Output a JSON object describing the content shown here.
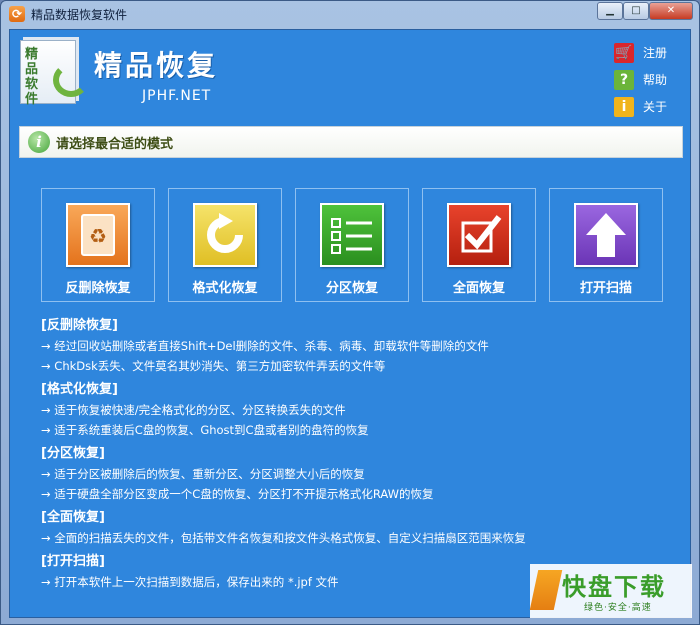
{
  "window": {
    "title": "精品数据恢复软件",
    "controls": {
      "minimize": "▁",
      "maximize": "□",
      "close": "✕"
    }
  },
  "brand": {
    "logo_text": "精品软件",
    "title": "精品恢复",
    "url": "JPHF.NET"
  },
  "toplinks": [
    {
      "label": "注册",
      "icon": "cart-icon",
      "color": "#d9262c"
    },
    {
      "label": "帮助",
      "icon": "help-icon",
      "color": "#6bb43a"
    },
    {
      "label": "关于",
      "icon": "info-icon",
      "color": "#f0b41c"
    }
  ],
  "notice": {
    "text": "请选择最合适的模式"
  },
  "modes": [
    {
      "label": "反删除恢复",
      "icon": "recycle-icon",
      "color": "#e98224"
    },
    {
      "label": "格式化恢复",
      "icon": "refresh-icon",
      "color": "#e7cc37"
    },
    {
      "label": "分区恢复",
      "icon": "checklist-icon",
      "color": "#35a928"
    },
    {
      "label": "全面恢复",
      "icon": "checkmark-icon",
      "color": "#d2321b"
    },
    {
      "label": "打开扫描",
      "icon": "arrow-up-icon",
      "color": "#7f4bcb"
    }
  ],
  "descriptions": [
    {
      "title": "[反删除恢复]",
      "lines": [
        "→ 经过回收站删除或者直接Shift+Del删除的文件、杀毒、病毒、卸载软件等删除的文件",
        "→ ChkDsk丢失、文件莫名其妙消失、第三方加密软件弄丢的文件等"
      ]
    },
    {
      "title": "[格式化恢复]",
      "lines": [
        "→ 适于恢复被快速/完全格式化的分区、分区转换丢失的文件",
        "→ 适于系统重装后C盘的恢复、Ghost到C盘或者别的盘符的恢复"
      ]
    },
    {
      "title": "[分区恢复]",
      "lines": [
        "→ 适于分区被删除后的恢复、重新分区、分区调整大小后的恢复",
        "→ 适于硬盘全部分区变成一个C盘的恢复、分区打不开提示格式化RAW的恢复"
      ]
    },
    {
      "title": "[全面恢复]",
      "lines": [
        "→ 全面的扫描丢失的文件，包括带文件名恢复和按文件头格式恢复、自定义扫描扇区范围来恢复"
      ]
    },
    {
      "title": "[打开扫描]",
      "lines": [
        "→ 打开本软件上一次扫描到数据后，保存出来的 *.jpf 文件"
      ]
    }
  ],
  "watermark": {
    "text": "快盘下载",
    "slogan": "绿色·安全·高速"
  }
}
